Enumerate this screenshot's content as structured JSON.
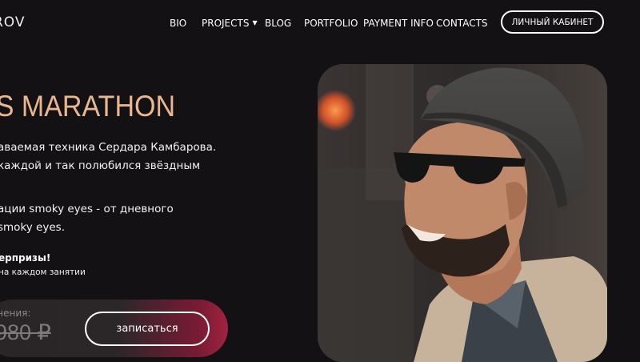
{
  "header": {
    "logo_text": "ROV",
    "nav": [
      {
        "label": "BIO",
        "dropdown": false
      },
      {
        "label": "PROJECTS",
        "dropdown": true
      },
      {
        "label": "BLOG",
        "dropdown": false
      },
      {
        "label": "PORTFOLIO",
        "dropdown": false
      },
      {
        "label": "PAYMENT INFO",
        "dropdown": false
      },
      {
        "label": "CONTACTS",
        "dropdown": false
      }
    ],
    "cabinet_button": "ЛИЧНЫЙ КАБИНЕТ"
  },
  "hero": {
    "title": "ES MARATHON",
    "desc_lines": [
      "аваемая техника Сердара Камбарова.",
      "каждой и так полюбился звёздным",
      "ации smoky eyes - от дневного",
      "smoky eyes."
    ],
    "bonus_title": "ерпризы!",
    "bonus_text": "на каждом занятии",
    "price_label": "чения:",
    "old_price": "980 ₽",
    "cta_button": "записаться"
  },
  "colors": {
    "background": "#131113",
    "accent_title": "#e9b690",
    "cta_glow": "#a0233f"
  },
  "icons": {
    "dropdown": "chevron-down-icon"
  }
}
